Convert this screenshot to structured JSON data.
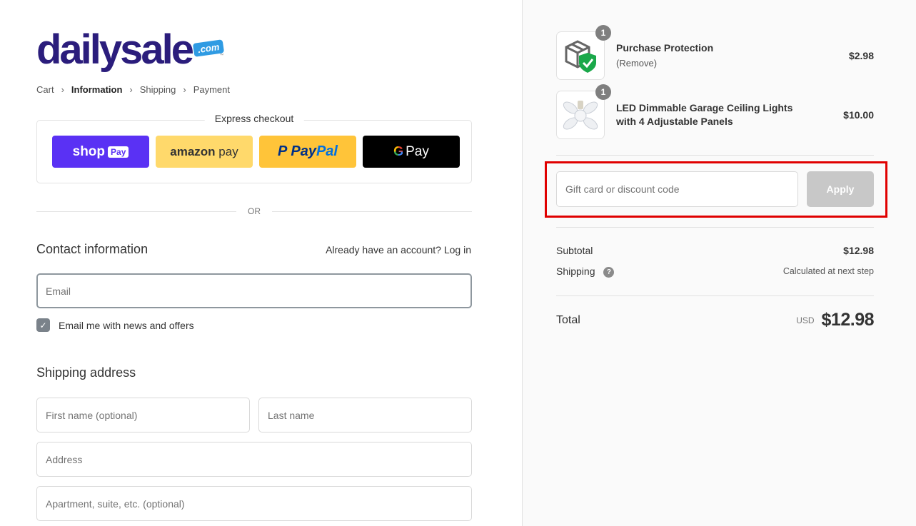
{
  "brand": {
    "name": "dailysale",
    "tld": ".com",
    "tm": "™",
    "color": "#2b1d7c",
    "tld_color": "#2f9be3"
  },
  "breadcrumb": [
    {
      "label": "Cart",
      "active": false
    },
    {
      "label": "Information",
      "active": true
    },
    {
      "label": "Shipping",
      "active": false
    },
    {
      "label": "Payment",
      "active": false
    }
  ],
  "breadcrumb_separator": "›",
  "express": {
    "title": "Express checkout",
    "buttons": {
      "shop_pay": {
        "text": "shop",
        "pill": "Pay",
        "color": "#5a31f4"
      },
      "amazon_pay": {
        "brand": "amazon",
        "suffix": "pay",
        "color": "#ffd96b"
      },
      "paypal": {
        "part1": "Pay",
        "part2": "Pal",
        "icon": "P",
        "color": "#ffc439"
      },
      "google_pay": {
        "g": "G",
        "text": "Pay",
        "color": "#000000"
      }
    }
  },
  "or_label": "OR",
  "contact": {
    "title": "Contact information",
    "login_prompt": "Already have an account?",
    "login_link": "Log in",
    "email_placeholder": "Email",
    "newsletter_label": "Email me with news and offers",
    "newsletter_checked": true
  },
  "shipping": {
    "title": "Shipping address",
    "first_name_placeholder": "First name (optional)",
    "last_name_placeholder": "Last name",
    "address_placeholder": "Address",
    "apartment_placeholder": "Apartment, suite, etc. (optional)"
  },
  "order": {
    "items": [
      {
        "name": "Purchase Protection",
        "sub": "(Remove)",
        "qty": "1",
        "price": "$2.98",
        "icon": "shield-box-icon"
      },
      {
        "name": "LED Dimmable Garage Ceiling Lights with 4 Adjustable Panels",
        "sub": "",
        "qty": "1",
        "price": "$10.00",
        "icon": "led-light-icon"
      }
    ],
    "discount_placeholder": "Gift card or discount code",
    "apply_label": "Apply",
    "subtotal_label": "Subtotal",
    "subtotal_value": "$12.98",
    "shipping_label": "Shipping",
    "shipping_help": "?",
    "shipping_value": "Calculated at next step",
    "total_label": "Total",
    "currency": "USD",
    "total_value": "$12.98",
    "highlight_color": "#e00000"
  }
}
